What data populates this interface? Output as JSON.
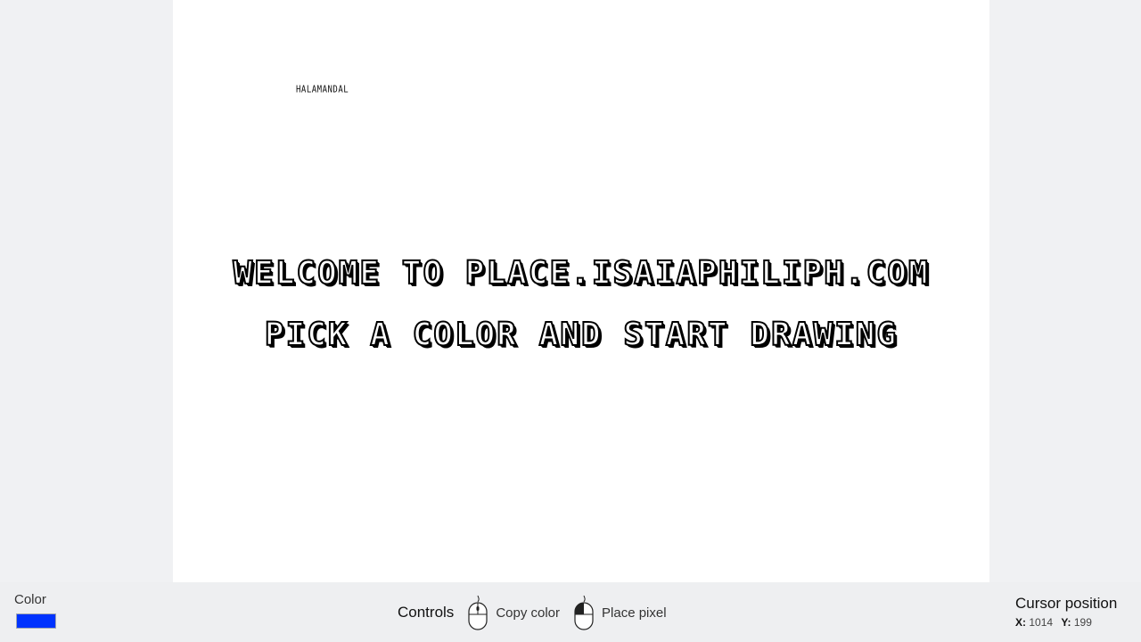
{
  "canvas": {
    "small_tag": "HALAMANDAL",
    "line1": "WELCOME TO PLACE.ISAIAPHILIPH.COM",
    "line2": "PICK A COLOR AND START DRAWING"
  },
  "color_panel": {
    "label": "Color",
    "selected_color": "#0033ff"
  },
  "controls": {
    "title": "Controls",
    "items": [
      {
        "icon": "mouse-right-click-icon",
        "label": "Copy color"
      },
      {
        "icon": "mouse-left-click-icon",
        "label": "Place pixel"
      }
    ]
  },
  "cursor": {
    "title": "Cursor position",
    "x_label": "X:",
    "x_value": "1014",
    "y_label": "Y:",
    "y_value": "199"
  }
}
